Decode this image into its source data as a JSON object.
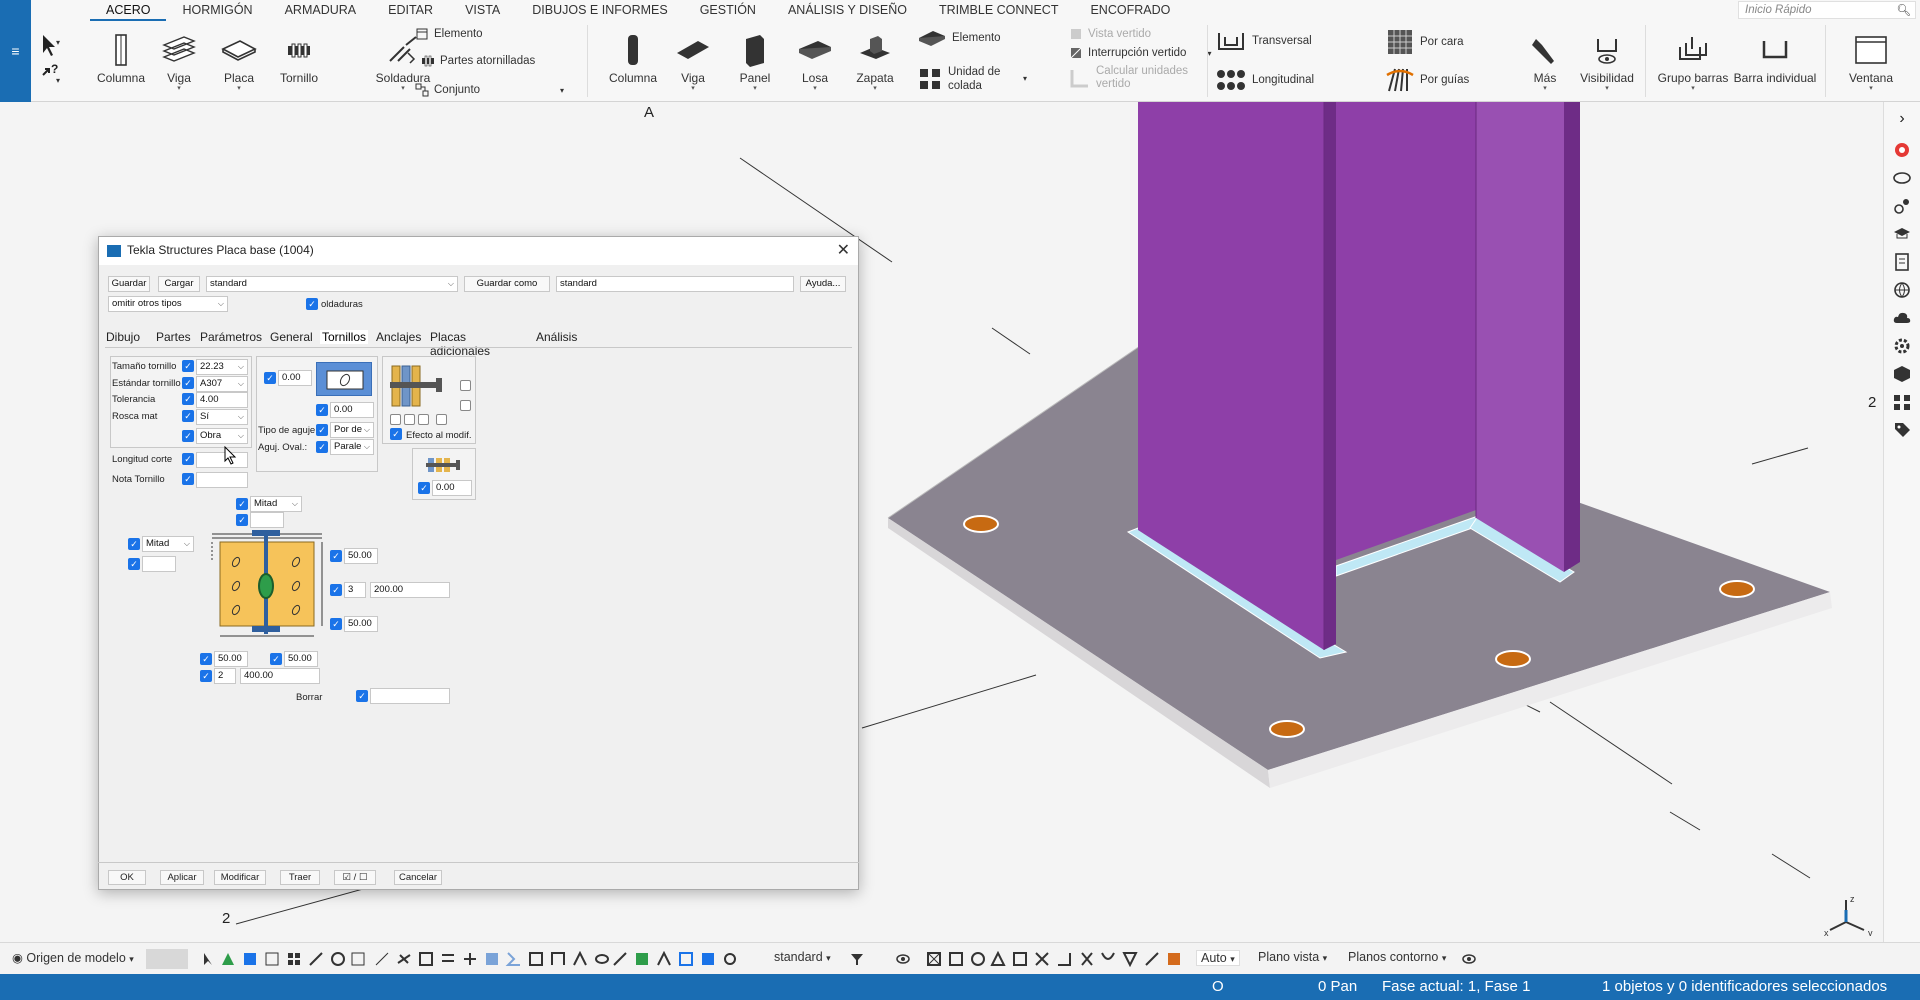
{
  "menu": {
    "items": [
      "ACERO",
      "HORMIGÓN",
      "ARMADURA",
      "EDITAR",
      "VISTA",
      "DIBUJOS E INFORMES",
      "GESTIÓN",
      "ANÁLISIS Y DISEÑO",
      "TRIMBLE CONNECT",
      "ENCOFRADO"
    ],
    "active": "ACERO",
    "quick_search_placeholder": "Inicio Rápido"
  },
  "ribbon": {
    "steel": {
      "columna": "Columna",
      "viga": "Viga",
      "placa": "Placa",
      "tornillo": "Tornillo",
      "soldadura": "Soldadura",
      "elemento": "Elemento",
      "partes_atornilladas": "Partes atornilladas",
      "conjunto": "Conjunto"
    },
    "concrete": {
      "columna": "Columna",
      "viga": "Viga",
      "panel": "Panel",
      "losa": "Losa",
      "zapata": "Zapata",
      "elemento": "Elemento",
      "unidad_colada": "Unidad de colada",
      "vista_vertido": "Vista vertido",
      "interrupcion_vertido": "Interrupción vertido",
      "calcular_unidades": "Calcular unidades vertido"
    },
    "rebar": {
      "transversal": "Transversal",
      "longitudinal": "Longitudinal",
      "por_cara": "Por cara",
      "por_guias": "Por guías"
    },
    "mas": "Más",
    "visibilidad": "Visibilidad",
    "grupo_barras": "Grupo barras",
    "barra_individual": "Barra individual",
    "ventana": "Ventana"
  },
  "viewport": {
    "labels": [
      "A",
      "2",
      "2"
    ]
  },
  "dialog": {
    "title": "Tekla Structures  Placa base (1004)",
    "buttons": {
      "guardar": "Guardar",
      "cargar": "Cargar",
      "guardar_como": "Guardar como",
      "ayuda": "Ayuda..."
    },
    "preset": "standard",
    "save_as_name": "standard",
    "filter": "omitir otros tipos",
    "soldaduras_label": "oldaduras",
    "tabs": [
      "Dibujo",
      "Partes",
      "Parámetros",
      "General",
      "Tornillos",
      "Anclajes",
      "Placas adicionales",
      "Análisis"
    ],
    "active_tab": "Tornillos",
    "bolt": {
      "tamano_label": "Tamaño tornillo",
      "tamano_value": "22.23",
      "estandar_label": "Estándar tornillo",
      "estandar_value": "A307",
      "tolerancia_label": "Tolerancia",
      "tolerancia_value": "4.00",
      "rosca_label": "Rosca mat",
      "rosca_value": "Sí",
      "obra_value": "Obra",
      "longitud_label": "Longitud corte",
      "nota_label": "Nota Tornillo"
    },
    "hole": {
      "offset1": "0.00",
      "offset2": "0.00",
      "tipo_label": "Tipo de aguje",
      "tipo_value": "Por de",
      "oval_label": "Aguj. Oval.:",
      "oval_value": "Parale",
      "efecto_label": "Efecto al modif.",
      "washer_value": "0.00"
    },
    "layout": {
      "top_combo": "Mitad",
      "left_combo": "Mitad",
      "right_top": "50.00",
      "right_count": "3",
      "right_spacing": "200.00",
      "right_bottom": "50.00",
      "bottom_left": "50.00",
      "bottom_right": "50.00",
      "bottom_count": "2",
      "bottom_spacing": "400.00",
      "borrar_label": "Borrar"
    },
    "footer": {
      "ok": "OK",
      "aplicar": "Aplicar",
      "modificar": "Modificar",
      "traer": "Traer",
      "toggle": "☑ / ☐",
      "cancelar": "Cancelar"
    }
  },
  "bottombar": {
    "origin": "Origen de modelo",
    "filter": "standard",
    "auto": "Auto",
    "plano_vista": "Plano vista",
    "planos_contorno": "Planos contorno"
  },
  "status": {
    "o": "O",
    "pan": "0 Pan",
    "fase": "Fase actual: 1, Fase 1",
    "seleccion": "1 objetos y 0 identificadores seleccionados"
  },
  "colors": {
    "accent": "#1a6db3",
    "column": "#8e3fa8",
    "plate": "#8a8490",
    "hole": "#c76a12",
    "weld": "#bfe8f5"
  }
}
